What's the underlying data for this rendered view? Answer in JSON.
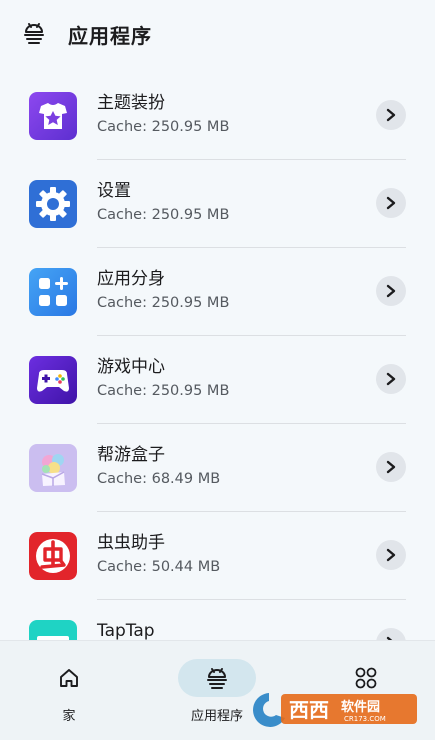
{
  "header": {
    "title": "应用程序",
    "menu_icon": "android-icon"
  },
  "apps": [
    {
      "name": "主题装扮",
      "cache": "Cache: 250.95 MB",
      "icon": "theme-shirt-icon",
      "color": "#7b3fe0"
    },
    {
      "name": "设置",
      "cache": "Cache: 250.95 MB",
      "icon": "gear-icon",
      "color": "#2f6fd6"
    },
    {
      "name": "应用分身",
      "cache": "Cache: 250.95 MB",
      "icon": "app-clone-icon",
      "color": "#2f88ea"
    },
    {
      "name": "游戏中心",
      "cache": "Cache: 250.95 MB",
      "icon": "gamepad-icon",
      "color": "#5a1fc8"
    },
    {
      "name": "帮游盒子",
      "cache": "Cache: 68.49 MB",
      "icon": "gift-box-icon",
      "color": "#b9a7e6"
    },
    {
      "name": "虫虫助手",
      "cache": "Cache: 50.44 MB",
      "icon": "chongchong-icon",
      "color": "#e2252b"
    },
    {
      "name": "TapTap",
      "cache": "",
      "icon": "taptap-icon",
      "color": "#1fd3c4"
    }
  ],
  "nav": [
    {
      "label": "家",
      "icon": "home-icon"
    },
    {
      "label": "应用程序",
      "icon": "android-icon"
    },
    {
      "label": "",
      "icon": "grid-icon"
    }
  ],
  "watermark": {
    "text_main": "西西",
    "text_sub": "软件园",
    "url": "CR173.COM"
  }
}
